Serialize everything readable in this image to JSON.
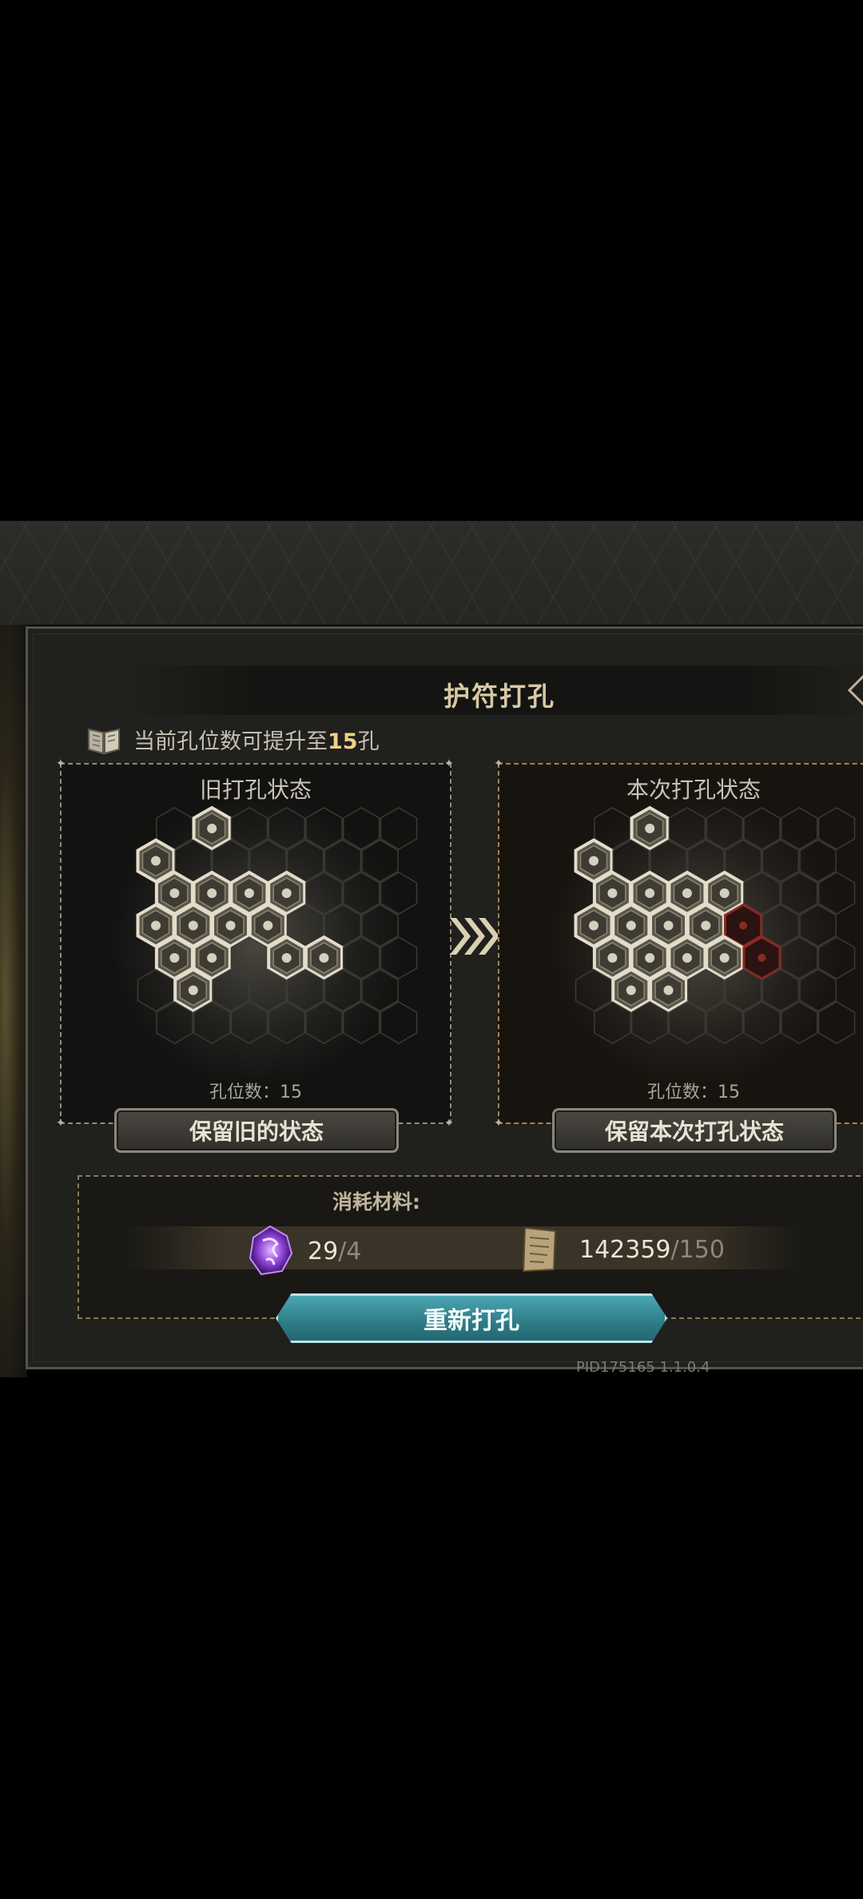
{
  "dialog": {
    "title": "护符打孔",
    "info_prefix": "当前孔位数可提升至",
    "info_number": "15",
    "info_suffix": "孔"
  },
  "old_state": {
    "title": "旧打孔状态",
    "count_label": "孔位数：15",
    "keep_button": "保留旧的状态",
    "filled_cells": [
      "r0c1",
      "r1c0",
      "r2c0",
      "r2c1",
      "r2c2",
      "r2c3",
      "r3c0",
      "r3c1",
      "r3c2",
      "r3c3",
      "r4c0",
      "r4c1",
      "r4c3",
      "r4c4",
      "r5c1"
    ]
  },
  "new_state": {
    "title": "本次打孔状态",
    "count_label": "孔位数：15",
    "keep_button": "保留本次打孔状态",
    "filled_cells": [
      "r0c1",
      "r1c0",
      "r2c0",
      "r2c1",
      "r2c2",
      "r2c3",
      "r3c0",
      "r3c1",
      "r3c2",
      "r3c3",
      "r4c0",
      "r4c1",
      "r4c2",
      "r4c3",
      "r5c1",
      "r5c2"
    ],
    "red_cells": [
      "r3c4",
      "r4c4"
    ]
  },
  "materials": {
    "label": "消耗材料:",
    "items": [
      {
        "icon": "purple-crystal-icon",
        "have": "29",
        "sep": "/",
        "need": "4"
      },
      {
        "icon": "scroll-icon",
        "have": "142359",
        "sep": "/",
        "need": "150"
      }
    ]
  },
  "rehole_button": "重新打孔",
  "pid": "PID175165  1.1.0.4",
  "colors": {
    "accent_number": "#f0d18a",
    "button_teal": "#2e7c86",
    "red_hole": "#8a2a22"
  }
}
